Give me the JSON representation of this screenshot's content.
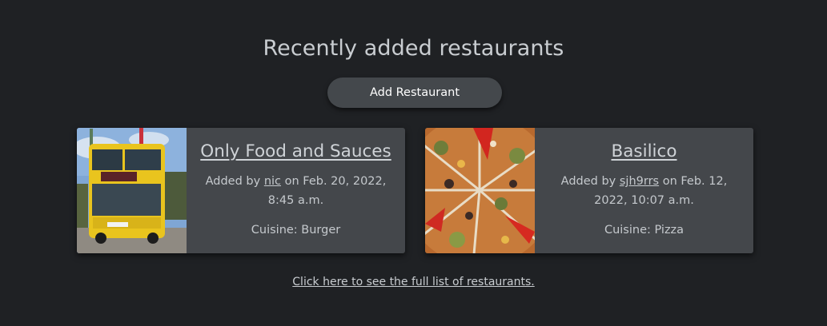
{
  "heading": "Recently added restaurants",
  "add_button": "Add Restaurant",
  "restaurants": [
    {
      "name": "Only Food and Sauces",
      "added_by_prefix": "Added by",
      "user": "nic",
      "date_text": "on Feb. 20, 2022, 8:45 a.m.",
      "cuisine": "Cuisine: Burger",
      "image": "yellow-double-decker-bus-photo"
    },
    {
      "name": "Basilico",
      "added_by_prefix": "Added by",
      "user": "sjh9rrs",
      "date_text": "on Feb. 12, 2022, 10:07 a.m.",
      "cuisine": "Cuisine: Pizza",
      "image": "sliced-pizza-photo"
    }
  ],
  "footer_link": "Click here to see the full list of restaurants.",
  "colors": {
    "background": "#1f2124",
    "card": "#44474b",
    "button": "#44484c",
    "text": "#c8ccd0"
  }
}
